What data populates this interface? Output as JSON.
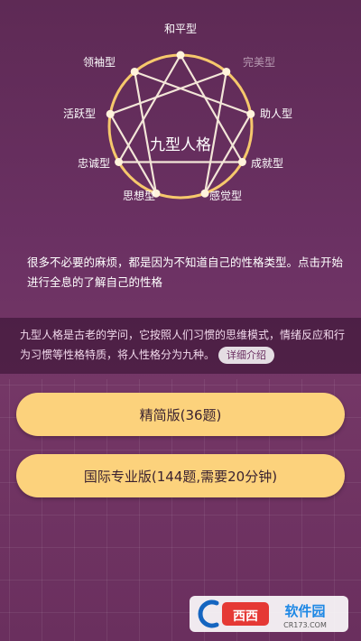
{
  "enneagram": {
    "center_label": "九型人格",
    "types": [
      {
        "key": "peacemaker",
        "label": "和平型",
        "muted": false
      },
      {
        "key": "perfectionist",
        "label": "完美型",
        "muted": true
      },
      {
        "key": "helper",
        "label": "助人型",
        "muted": false
      },
      {
        "key": "achiever",
        "label": "成就型",
        "muted": false
      },
      {
        "key": "individualist",
        "label": "感觉型",
        "muted": false
      },
      {
        "key": "investigator",
        "label": "思想型",
        "muted": false
      },
      {
        "key": "loyalist",
        "label": "忠诚型",
        "muted": false
      },
      {
        "key": "enthusiast",
        "label": "活跃型",
        "muted": false
      },
      {
        "key": "challenger",
        "label": "领袖型",
        "muted": false
      }
    ],
    "colors": {
      "ring": "#f6c86c",
      "label": "#ffffff",
      "label_muted": "#b89bb2"
    }
  },
  "intro": {
    "text": "很多不必要的麻烦，都是因为不知道自己的性格类型。点击开始进行全息的了解自己的性格"
  },
  "description": {
    "text": "九型人格是古老的学问，它按照人们习惯的思维模式，情绪反应和行为习惯等性格特质，将人性格分为九种。",
    "detail_button": "详细介绍"
  },
  "tests": {
    "simple_label": "精简版(36题)",
    "pro_label": "国际专业版(144题,需要20分钟)"
  },
  "watermark": {
    "brand": "西西软件园",
    "domain": "CR173.COM"
  },
  "colors": {
    "accent": "#fcd27c",
    "background": "#6b3163"
  }
}
